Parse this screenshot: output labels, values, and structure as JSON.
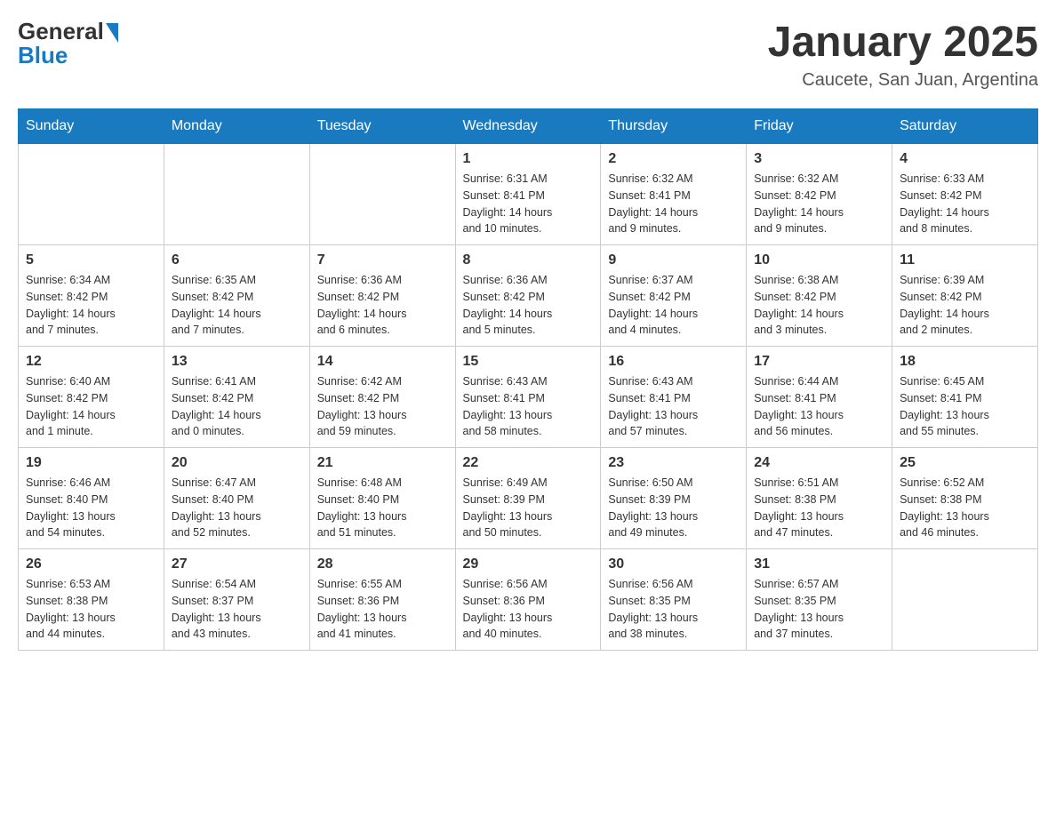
{
  "header": {
    "logo": {
      "text_general": "General",
      "text_blue": "Blue",
      "aria": "GeneralBlue logo"
    },
    "title": "January 2025",
    "location": "Caucete, San Juan, Argentina"
  },
  "calendar": {
    "days_of_week": [
      "Sunday",
      "Monday",
      "Tuesday",
      "Wednesday",
      "Thursday",
      "Friday",
      "Saturday"
    ],
    "weeks": [
      [
        {
          "day": "",
          "info": ""
        },
        {
          "day": "",
          "info": ""
        },
        {
          "day": "",
          "info": ""
        },
        {
          "day": "1",
          "info": "Sunrise: 6:31 AM\nSunset: 8:41 PM\nDaylight: 14 hours\nand 10 minutes."
        },
        {
          "day": "2",
          "info": "Sunrise: 6:32 AM\nSunset: 8:41 PM\nDaylight: 14 hours\nand 9 minutes."
        },
        {
          "day": "3",
          "info": "Sunrise: 6:32 AM\nSunset: 8:42 PM\nDaylight: 14 hours\nand 9 minutes."
        },
        {
          "day": "4",
          "info": "Sunrise: 6:33 AM\nSunset: 8:42 PM\nDaylight: 14 hours\nand 8 minutes."
        }
      ],
      [
        {
          "day": "5",
          "info": "Sunrise: 6:34 AM\nSunset: 8:42 PM\nDaylight: 14 hours\nand 7 minutes."
        },
        {
          "day": "6",
          "info": "Sunrise: 6:35 AM\nSunset: 8:42 PM\nDaylight: 14 hours\nand 7 minutes."
        },
        {
          "day": "7",
          "info": "Sunrise: 6:36 AM\nSunset: 8:42 PM\nDaylight: 14 hours\nand 6 minutes."
        },
        {
          "day": "8",
          "info": "Sunrise: 6:36 AM\nSunset: 8:42 PM\nDaylight: 14 hours\nand 5 minutes."
        },
        {
          "day": "9",
          "info": "Sunrise: 6:37 AM\nSunset: 8:42 PM\nDaylight: 14 hours\nand 4 minutes."
        },
        {
          "day": "10",
          "info": "Sunrise: 6:38 AM\nSunset: 8:42 PM\nDaylight: 14 hours\nand 3 minutes."
        },
        {
          "day": "11",
          "info": "Sunrise: 6:39 AM\nSunset: 8:42 PM\nDaylight: 14 hours\nand 2 minutes."
        }
      ],
      [
        {
          "day": "12",
          "info": "Sunrise: 6:40 AM\nSunset: 8:42 PM\nDaylight: 14 hours\nand 1 minute."
        },
        {
          "day": "13",
          "info": "Sunrise: 6:41 AM\nSunset: 8:42 PM\nDaylight: 14 hours\nand 0 minutes."
        },
        {
          "day": "14",
          "info": "Sunrise: 6:42 AM\nSunset: 8:42 PM\nDaylight: 13 hours\nand 59 minutes."
        },
        {
          "day": "15",
          "info": "Sunrise: 6:43 AM\nSunset: 8:41 PM\nDaylight: 13 hours\nand 58 minutes."
        },
        {
          "day": "16",
          "info": "Sunrise: 6:43 AM\nSunset: 8:41 PM\nDaylight: 13 hours\nand 57 minutes."
        },
        {
          "day": "17",
          "info": "Sunrise: 6:44 AM\nSunset: 8:41 PM\nDaylight: 13 hours\nand 56 minutes."
        },
        {
          "day": "18",
          "info": "Sunrise: 6:45 AM\nSunset: 8:41 PM\nDaylight: 13 hours\nand 55 minutes."
        }
      ],
      [
        {
          "day": "19",
          "info": "Sunrise: 6:46 AM\nSunset: 8:40 PM\nDaylight: 13 hours\nand 54 minutes."
        },
        {
          "day": "20",
          "info": "Sunrise: 6:47 AM\nSunset: 8:40 PM\nDaylight: 13 hours\nand 52 minutes."
        },
        {
          "day": "21",
          "info": "Sunrise: 6:48 AM\nSunset: 8:40 PM\nDaylight: 13 hours\nand 51 minutes."
        },
        {
          "day": "22",
          "info": "Sunrise: 6:49 AM\nSunset: 8:39 PM\nDaylight: 13 hours\nand 50 minutes."
        },
        {
          "day": "23",
          "info": "Sunrise: 6:50 AM\nSunset: 8:39 PM\nDaylight: 13 hours\nand 49 minutes."
        },
        {
          "day": "24",
          "info": "Sunrise: 6:51 AM\nSunset: 8:38 PM\nDaylight: 13 hours\nand 47 minutes."
        },
        {
          "day": "25",
          "info": "Sunrise: 6:52 AM\nSunset: 8:38 PM\nDaylight: 13 hours\nand 46 minutes."
        }
      ],
      [
        {
          "day": "26",
          "info": "Sunrise: 6:53 AM\nSunset: 8:38 PM\nDaylight: 13 hours\nand 44 minutes."
        },
        {
          "day": "27",
          "info": "Sunrise: 6:54 AM\nSunset: 8:37 PM\nDaylight: 13 hours\nand 43 minutes."
        },
        {
          "day": "28",
          "info": "Sunrise: 6:55 AM\nSunset: 8:36 PM\nDaylight: 13 hours\nand 41 minutes."
        },
        {
          "day": "29",
          "info": "Sunrise: 6:56 AM\nSunset: 8:36 PM\nDaylight: 13 hours\nand 40 minutes."
        },
        {
          "day": "30",
          "info": "Sunrise: 6:56 AM\nSunset: 8:35 PM\nDaylight: 13 hours\nand 38 minutes."
        },
        {
          "day": "31",
          "info": "Sunrise: 6:57 AM\nSunset: 8:35 PM\nDaylight: 13 hours\nand 37 minutes."
        },
        {
          "day": "",
          "info": ""
        }
      ]
    ]
  }
}
